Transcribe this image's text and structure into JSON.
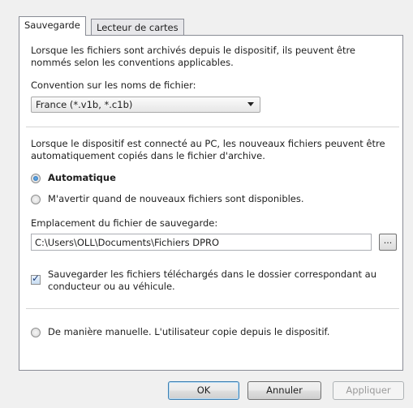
{
  "tabs": [
    {
      "label": "Sauvegarde",
      "active": true
    },
    {
      "label": "Lecteur de cartes",
      "active": false
    }
  ],
  "archive": {
    "intro": "Lorsque les fichiers sont archivés depuis le dispositif, ils peuvent être nommés selon les conventions applicables.",
    "naming_label": "Convention sur les noms de fichier:",
    "naming_value": "France (*.v1b, *.c1b)"
  },
  "auto": {
    "intro": "Lorsque le dispositif est connecté au PC, les nouveaux fichiers peuvent être automatiquement copiés dans le fichier d'archive.",
    "option_auto": "Automatique",
    "option_notify": "M'avertir quand de nouveaux fichiers sont disponibles.",
    "location_label": "Emplacement du fichier de sauvegarde:",
    "location_value": "C:\\Users\\OLL\\Documents\\Fichiers DPRO",
    "browse_label": "...",
    "checkbox_label": "Sauvegarder les fichiers téléchargés dans le dossier correspondant au conducteur ou au véhicule.",
    "checkbox_checked": true
  },
  "manual": {
    "option_manual": "De manière manuelle. L'utilisateur copie depuis le dispositif."
  },
  "buttons": {
    "ok": "OK",
    "cancel": "Annuler",
    "apply": "Appliquer"
  }
}
